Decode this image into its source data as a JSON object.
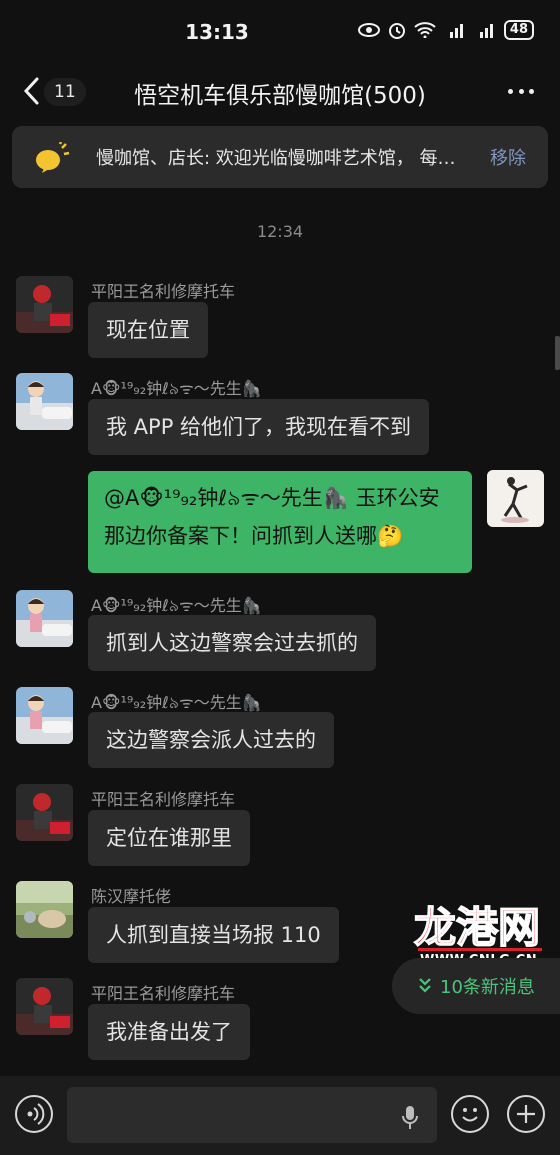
{
  "status": {
    "time": "13:13",
    "battery": "48"
  },
  "nav": {
    "unread_count": "11",
    "title": "悟空机车俱乐部慢咖馆(500)"
  },
  "notice": {
    "text": "慢咖馆、店长: 欢迎光临慢咖啡艺术馆， 每…",
    "remove_label": "移除"
  },
  "timestamp": "12:34",
  "messages": [
    {
      "sender": "平阳王名利修摩托车",
      "text": "现在位置"
    },
    {
      "sender": "A🐵¹⁹₉₂钟ℓ৯ᯤ〜先生🦍",
      "text": "我 APP 给他们了，我现在看不到"
    },
    {
      "sender": "",
      "text_line1": "@A🐵¹⁹₉₂钟ℓ৯ᯤ〜先生🦍 玉环公安",
      "text_line2": "那边你备案下！问抓到人送哪🤔"
    },
    {
      "sender": "A🐵¹⁹₉₂钟ℓ৯ᯤ〜先生🦍",
      "text": "抓到人这边警察会过去抓的"
    },
    {
      "sender": "A🐵¹⁹₉₂钟ℓ৯ᯤ〜先生🦍",
      "text": "这边警察会派人过去的"
    },
    {
      "sender": "平阳王名利修摩托车",
      "text": "定位在谁那里"
    },
    {
      "sender": "陈汉摩托佬",
      "text": "人抓到直接当场报 110"
    },
    {
      "sender": "平阳王名利修摩托车",
      "text": "我准备出发了"
    }
  ],
  "watermark": {
    "logo_text": "龙港网",
    "url": "WWW.CNLG.CN"
  },
  "new_messages": {
    "label": "10条新消息"
  },
  "input": {
    "placeholder": ""
  },
  "colors": {
    "background": "#111111",
    "bubble_other": "#2c2c2c",
    "bubble_self": "#3eb566",
    "accent_green": "#4cc47a",
    "link_blue": "#7f96bf"
  },
  "icons": [
    "back-chevron-icon",
    "more-icon",
    "speaker-icon",
    "voice-icon",
    "microphone-icon",
    "emoji-icon",
    "plus-icon",
    "double-chevron-down-icon"
  ]
}
